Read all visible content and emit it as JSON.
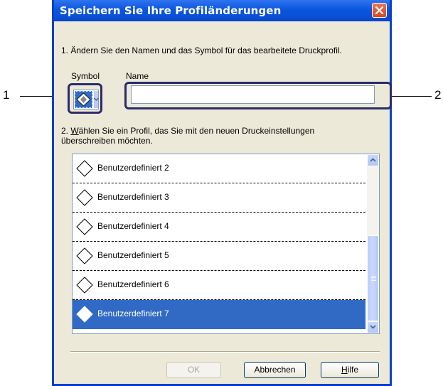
{
  "callouts": {
    "left": "1",
    "right": "2"
  },
  "dialog": {
    "title": "Speichern Sie Ihre Profiländerungen",
    "instruction1": "1. Ändern Sie den Namen und das Symbol für das bearbeitete Druckprofil.",
    "symbol_label": "Symbol",
    "name_label": "Name",
    "name_value": "",
    "instruction2_prefix": "2. ",
    "instruction2_mnemonic": "W",
    "instruction2_rest": "ählen Sie ein Profil, das Sie mit den neuen Druckeinstellungen",
    "instruction2_line2": "überschreiben möchten.",
    "profiles": [
      {
        "label": "Benutzerdefiniert 2"
      },
      {
        "label": "Benutzerdefiniert 3"
      },
      {
        "label": "Benutzerdefiniert 4"
      },
      {
        "label": "Benutzerdefiniert 5"
      },
      {
        "label": "Benutzerdefiniert 6"
      },
      {
        "label": "Benutzerdefiniert 7"
      }
    ],
    "selected_index": 5,
    "buttons": {
      "ok": "OK",
      "cancel": "Abbrechen",
      "help_mnemonic": "H",
      "help_rest": "ilfe"
    }
  },
  "colors": {
    "selection": "#316ac5",
    "titlebar": "#0a54de",
    "callout_ring": "#2b2b6b"
  }
}
